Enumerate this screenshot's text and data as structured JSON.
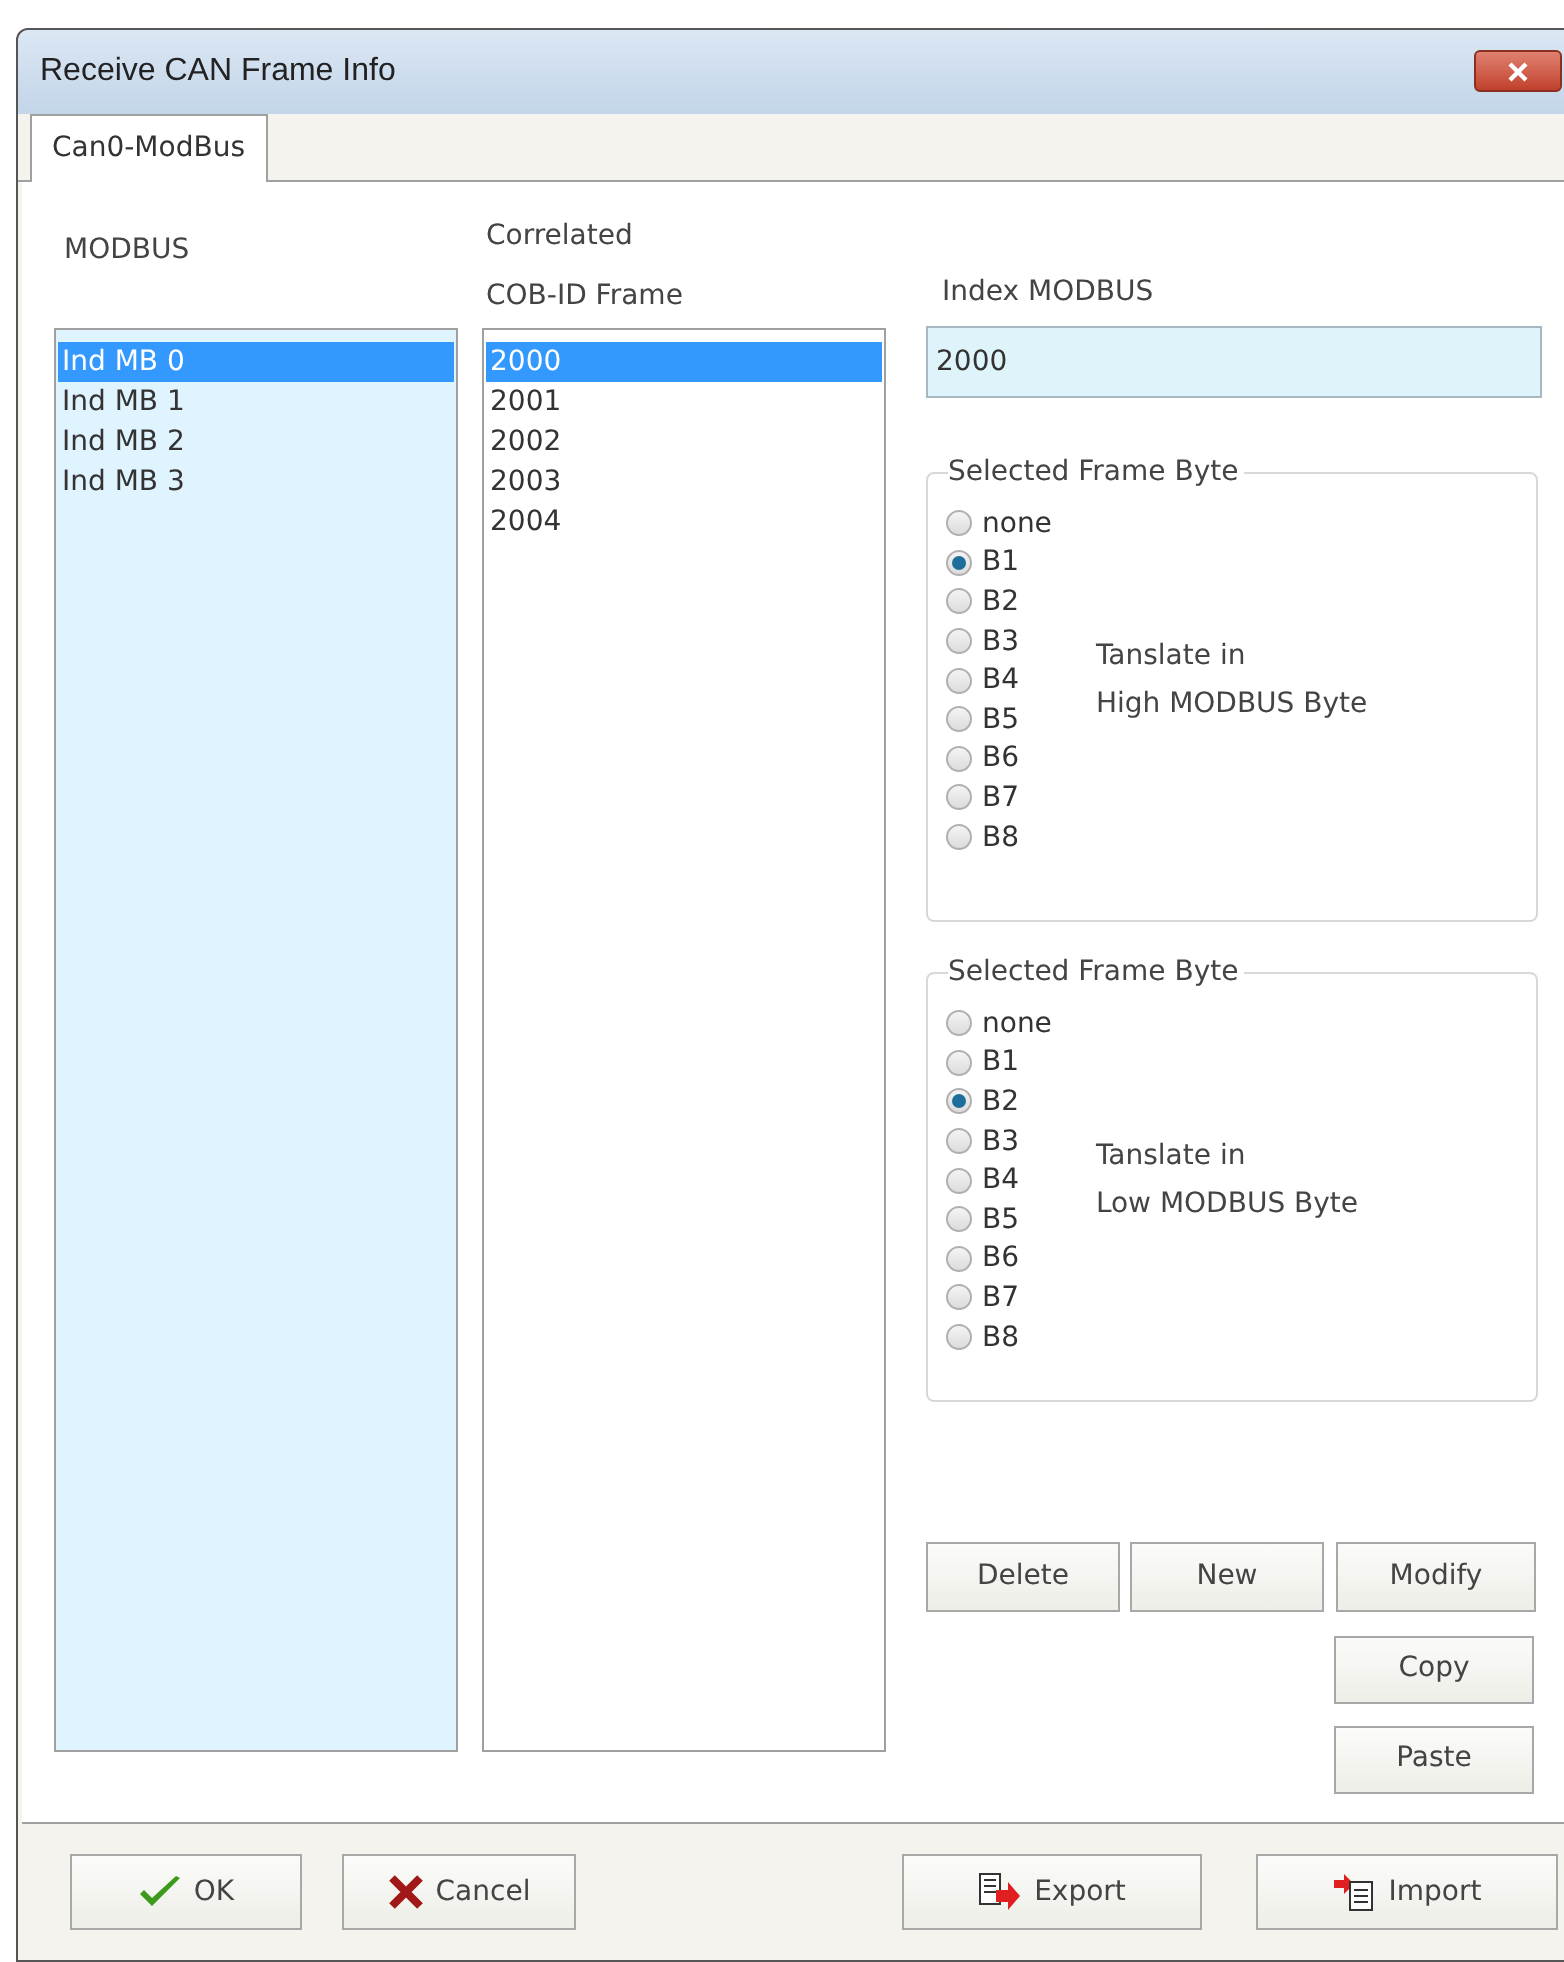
{
  "window": {
    "title": "Receive CAN Frame Info"
  },
  "tabs": [
    {
      "label": "Can0-ModBus",
      "selected": true
    }
  ],
  "modbus": {
    "label": "MODBUS",
    "items": [
      {
        "label": "Ind MB 0",
        "selected": true
      },
      {
        "label": "Ind MB 1",
        "selected": false
      },
      {
        "label": "Ind MB 2",
        "selected": false
      },
      {
        "label": "Ind MB 3",
        "selected": false
      }
    ]
  },
  "cob_id": {
    "label_lines": [
      "Correlated",
      "COB-ID Frame"
    ],
    "items": [
      {
        "label": "2000",
        "selected": true
      },
      {
        "label": "2001",
        "selected": false
      },
      {
        "label": "2002",
        "selected": false
      },
      {
        "label": "2003",
        "selected": false
      },
      {
        "label": "2004",
        "selected": false
      }
    ]
  },
  "index_modbus": {
    "label": "Index MODBUS",
    "value": "2000"
  },
  "groups": [
    {
      "title": "Selected Frame Byte",
      "note_lines": [
        "Tanslate in",
        "High MODBUS Byte"
      ],
      "options": [
        {
          "label": "none",
          "selected": false
        },
        {
          "label": "B1",
          "selected": true
        },
        {
          "label": "B2",
          "selected": false
        },
        {
          "label": "B3",
          "selected": false
        },
        {
          "label": "B4",
          "selected": false
        },
        {
          "label": "B5",
          "selected": false
        },
        {
          "label": "B6",
          "selected": false
        },
        {
          "label": "B7",
          "selected": false
        },
        {
          "label": "B8",
          "selected": false
        }
      ]
    },
    {
      "title": "Selected Frame Byte",
      "note_lines": [
        "Tanslate in",
        "Low MODBUS Byte"
      ],
      "options": [
        {
          "label": "none",
          "selected": false
        },
        {
          "label": "B1",
          "selected": false
        },
        {
          "label": "B2",
          "selected": true
        },
        {
          "label": "B3",
          "selected": false
        },
        {
          "label": "B4",
          "selected": false
        },
        {
          "label": "B5",
          "selected": false
        },
        {
          "label": "B6",
          "selected": false
        },
        {
          "label": "B7",
          "selected": false
        },
        {
          "label": "B8",
          "selected": false
        }
      ]
    }
  ],
  "edit_buttons": [
    "Delete",
    "New",
    "Modify"
  ],
  "clipboard_buttons": [
    "Copy",
    "Paste"
  ],
  "footer_buttons": [
    {
      "label": "OK",
      "kind": "ok"
    },
    {
      "label": "Cancel",
      "kind": "cancel"
    },
    {
      "label": "Export",
      "kind": "export"
    },
    {
      "label": "Import",
      "kind": "import"
    }
  ]
}
